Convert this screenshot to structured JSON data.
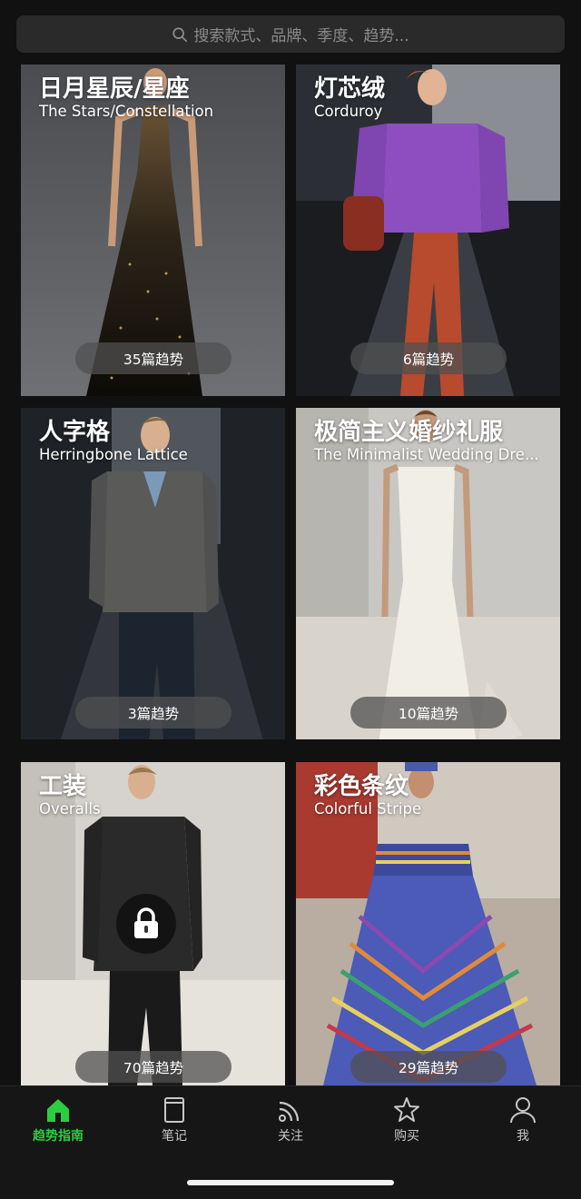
{
  "search": {
    "placeholder": "搜索款式、品牌、季度、趋势..."
  },
  "cards": [
    {
      "title": "日月星辰/星座",
      "subtitle": "The Stars/Constellation",
      "count": "35篇趋势"
    },
    {
      "title": "灯芯绒",
      "subtitle": "Corduroy",
      "count": "6篇趋势"
    },
    {
      "title": "人字格",
      "subtitle": "Herringbone Lattice",
      "count": "3篇趋势"
    },
    {
      "title": "极简主义婚纱礼服",
      "subtitle": "The Minimalist Wedding Dre...",
      "count": "10篇趋势"
    },
    {
      "title": "工装",
      "subtitle": "Overalls",
      "count": "70篇趋势",
      "locked": true
    },
    {
      "title": "彩色条纹",
      "subtitle": "Colorful Stripe",
      "count": "29篇趋势"
    }
  ],
  "tabs": [
    {
      "label": "趋势指南",
      "icon": "home-icon",
      "active": true
    },
    {
      "label": "笔记",
      "icon": "notebook-icon"
    },
    {
      "label": "关注",
      "icon": "rss-icon"
    },
    {
      "label": "购买",
      "icon": "star-icon"
    },
    {
      "label": "我",
      "icon": "user-icon"
    }
  ],
  "colors": {
    "accent": "#2ecc40",
    "background": "#111111",
    "tabbar": "#161616"
  }
}
